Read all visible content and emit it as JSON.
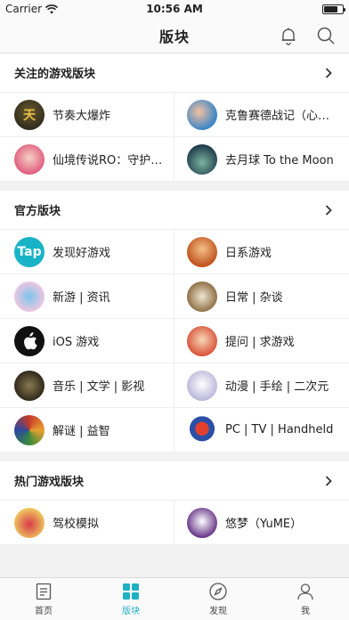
{
  "status_bar": {
    "carrier": "Carrier",
    "time": "10:56 AM",
    "battery_level": 0.75
  },
  "nav": {
    "title": "版块",
    "bell_icon": "bell-icon",
    "search_icon": "search-icon"
  },
  "colors": {
    "accent": "#1fb0c4",
    "tap_brand": "#19b3c7"
  },
  "sections": [
    {
      "title": "关注的游戏版块",
      "items": [
        {
          "label": "节奏大爆炸",
          "icon": "game-avatar"
        },
        {
          "label": "克鲁赛德战记（心…",
          "icon": "game-avatar"
        },
        {
          "label": "仙境传说RO：守护…",
          "icon": "game-avatar"
        },
        {
          "label": "去月球 To the Moon",
          "icon": "game-avatar"
        }
      ]
    },
    {
      "title": "官方版块",
      "items": [
        {
          "label": "发现好游戏",
          "icon": "tap-logo",
          "logo_text": "Tap"
        },
        {
          "label": "日系游戏",
          "icon": "game-avatar"
        },
        {
          "label": "新游 | 资讯",
          "icon": "game-avatar"
        },
        {
          "label": "日常 | 杂谈",
          "icon": "game-avatar"
        },
        {
          "label": "iOS 游戏",
          "icon": "apple-icon"
        },
        {
          "label": "提问 | 求游戏",
          "icon": "game-avatar"
        },
        {
          "label": "音乐 | 文学 | 影视",
          "icon": "game-avatar"
        },
        {
          "label": "动漫 | 手绘 | 二次元",
          "icon": "game-avatar"
        },
        {
          "label": "解谜 | 益智",
          "icon": "game-avatar"
        },
        {
          "label": "PC | TV | Handheld",
          "icon": "game-avatar"
        }
      ]
    },
    {
      "title": "热门游戏版块",
      "items": [
        {
          "label": "驾校模拟",
          "icon": "game-avatar"
        },
        {
          "label": "悠梦（YuME）",
          "icon": "game-avatar"
        }
      ]
    }
  ],
  "tabs": [
    {
      "label": "首页",
      "icon": "home-icon",
      "active": false
    },
    {
      "label": "版块",
      "icon": "grid-icon",
      "active": true
    },
    {
      "label": "发现",
      "icon": "compass-icon",
      "active": false
    },
    {
      "label": "我",
      "icon": "user-icon",
      "active": false
    }
  ]
}
